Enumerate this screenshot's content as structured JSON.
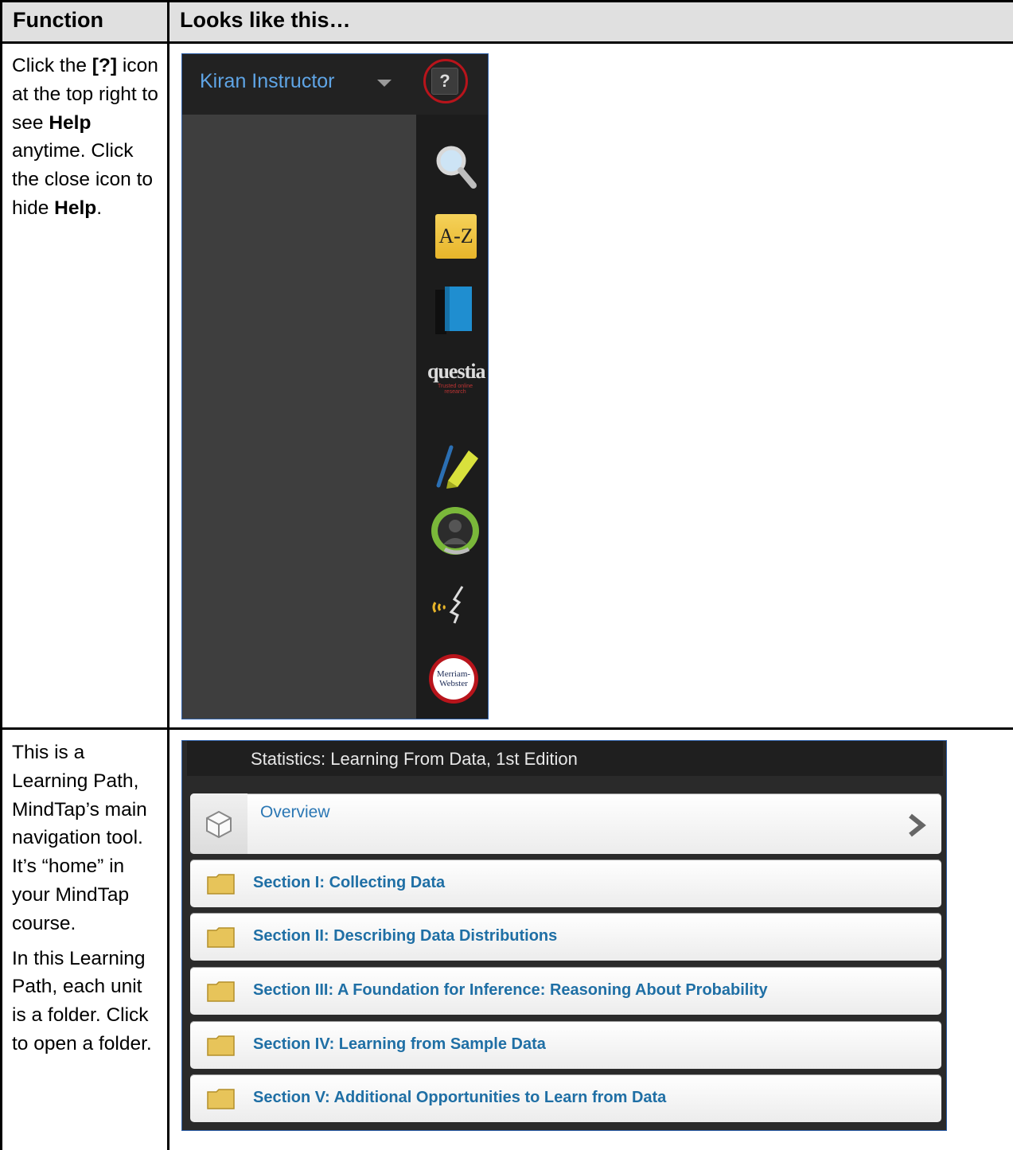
{
  "table": {
    "header": {
      "col1": "Function",
      "col2": "Looks like this…"
    },
    "row1": {
      "function_lines": [
        "Click the ",
        "[?]",
        " icon at the top right to see ",
        "Help",
        " anytime. Click the close icon to hide ",
        "Help",
        "."
      ],
      "screenshot": {
        "user_name": "Kiran Instructor",
        "help_button": "?",
        "rail_icons": [
          "search-icon",
          "a-z-icon",
          "book-icon",
          "questia-icon",
          "highlighter-icon",
          "avatar-icon",
          "readspeaker-icon",
          "merriam-webster-icon"
        ],
        "az_text": "A-Z",
        "questia_text": "questia",
        "questia_tag": "Trusted online research",
        "mw_text_line1": "Merriam-",
        "mw_text_line2": "Webster"
      }
    },
    "row2": {
      "function_p1": "This is a Learning Path, MindTap’s main navigation tool. It’s “home” in your MindTap course.",
      "function_p2": "In this Learning Path, each unit is a folder. Click to open a folder.",
      "screenshot": {
        "course_title": "Statistics: Learning From Data, 1st Edition",
        "overview": "Overview",
        "sections": [
          "Section I: Collecting Data",
          "Section II: Describing Data Distributions",
          "Section III: A Foundation for Inference: Reasoning About Probability",
          "Section IV: Learning from Sample Data",
          "Section V: Additional Opportunities to Learn from Data"
        ]
      }
    }
  },
  "colors": {
    "link_blue": "#1f6fa5",
    "header_gray": "#e0e0e0",
    "help_ring": "#b8141b",
    "folder": "#e7c45a"
  }
}
